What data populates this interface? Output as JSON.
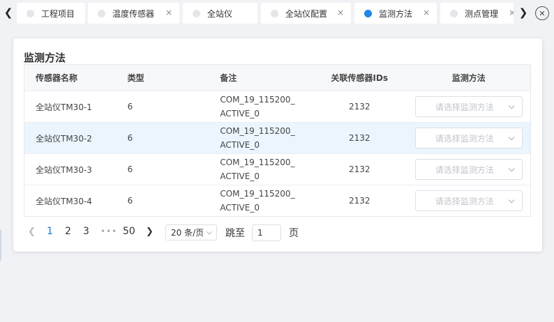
{
  "tabbar": {
    "tabs": [
      {
        "label": "工程项目",
        "closable": false,
        "active": false
      },
      {
        "label": "温度传感器",
        "closable": true,
        "active": false
      },
      {
        "label": "全站仪",
        "closable": true,
        "active": false
      },
      {
        "label": "全站仪配置",
        "closable": true,
        "active": false
      },
      {
        "label": "监测方法",
        "closable": true,
        "active": true
      },
      {
        "label": "测点管理",
        "closable": true,
        "active": false
      }
    ],
    "close_glyph": "×"
  },
  "card": {
    "title": "监测方法",
    "columns": [
      "传感器名称",
      "类型",
      "备注",
      "关联传感器IDs",
      "监测方法"
    ],
    "rows": [
      {
        "name": "全站仪TM30-1",
        "type": "6",
        "remark_line1": "COM_19_115200_",
        "remark_line2": "ACTIVE_0",
        "ids": "2132",
        "method_placeholder": "请选择监测方法"
      },
      {
        "name": "全站仪TM30-2",
        "type": "6",
        "remark_line1": "COM_19_115200_",
        "remark_line2": "ACTIVE_0",
        "ids": "2132",
        "method_placeholder": "请选择监测方法"
      },
      {
        "name": "全站仪TM30-3",
        "type": "6",
        "remark_line1": "COM_19_115200_",
        "remark_line2": "ACTIVE_0",
        "ids": "2132",
        "method_placeholder": "请选择监测方法"
      },
      {
        "name": "全站仪TM30-4",
        "type": "6",
        "remark_line1": "COM_19_115200_",
        "remark_line2": "ACTIVE_0",
        "ids": "2132",
        "method_placeholder": "请选择监测方法"
      }
    ]
  },
  "pagination": {
    "pages": [
      "1",
      "2",
      "3"
    ],
    "more": "•••",
    "last": "50",
    "current": "1",
    "page_size": "20 条/页",
    "jump_label": "跳至",
    "jump_value": "1",
    "page_suffix": "页"
  },
  "colors": {
    "accent": "#1976d2",
    "active_dot": "#1e88e5",
    "row_highlight": "#eaf5fd"
  }
}
